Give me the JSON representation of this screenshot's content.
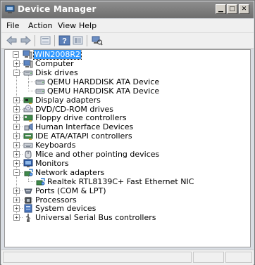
{
  "window": {
    "title": "Device Manager"
  },
  "menu": [
    "File",
    "Action",
    "View",
    "Help"
  ],
  "tree": {
    "root": "WIN2008R2",
    "nodes": [
      {
        "label": "Computer",
        "icon": "computer-icon",
        "expanded": false
      },
      {
        "label": "Disk drives",
        "icon": "disk-drive-icon",
        "expanded": true,
        "children": [
          {
            "label": "QEMU HARDDISK ATA Device",
            "icon": "disk-drive-icon"
          },
          {
            "label": "QEMU HARDDISK ATA Device",
            "icon": "disk-drive-icon"
          }
        ]
      },
      {
        "label": "Display adapters",
        "icon": "display-adapter-icon",
        "expanded": false
      },
      {
        "label": "DVD/CD-ROM drives",
        "icon": "dvd-drive-icon",
        "expanded": false
      },
      {
        "label": "Floppy drive controllers",
        "icon": "floppy-controller-icon",
        "expanded": false
      },
      {
        "label": "Human Interface Devices",
        "icon": "hid-icon",
        "expanded": false
      },
      {
        "label": "IDE ATA/ATAPI controllers",
        "icon": "ide-controller-icon",
        "expanded": false
      },
      {
        "label": "Keyboards",
        "icon": "keyboard-icon",
        "expanded": false
      },
      {
        "label": "Mice and other pointing devices",
        "icon": "mouse-icon",
        "expanded": false
      },
      {
        "label": "Monitors",
        "icon": "monitor-icon",
        "expanded": false
      },
      {
        "label": "Network adapters",
        "icon": "network-adapter-icon",
        "expanded": true,
        "children": [
          {
            "label": "Realtek RTL8139C+ Fast Ethernet NIC",
            "icon": "network-adapter-icon"
          }
        ]
      },
      {
        "label": "Ports (COM & LPT)",
        "icon": "port-icon",
        "expanded": false
      },
      {
        "label": "Processors",
        "icon": "processor-icon",
        "expanded": false
      },
      {
        "label": "System devices",
        "icon": "system-device-icon",
        "expanded": false
      },
      {
        "label": "Universal Serial Bus controllers",
        "icon": "usb-controller-icon",
        "expanded": false
      }
    ]
  },
  "colors": {
    "selection": "#3399ff",
    "titlebar": "#7e7e7e"
  }
}
